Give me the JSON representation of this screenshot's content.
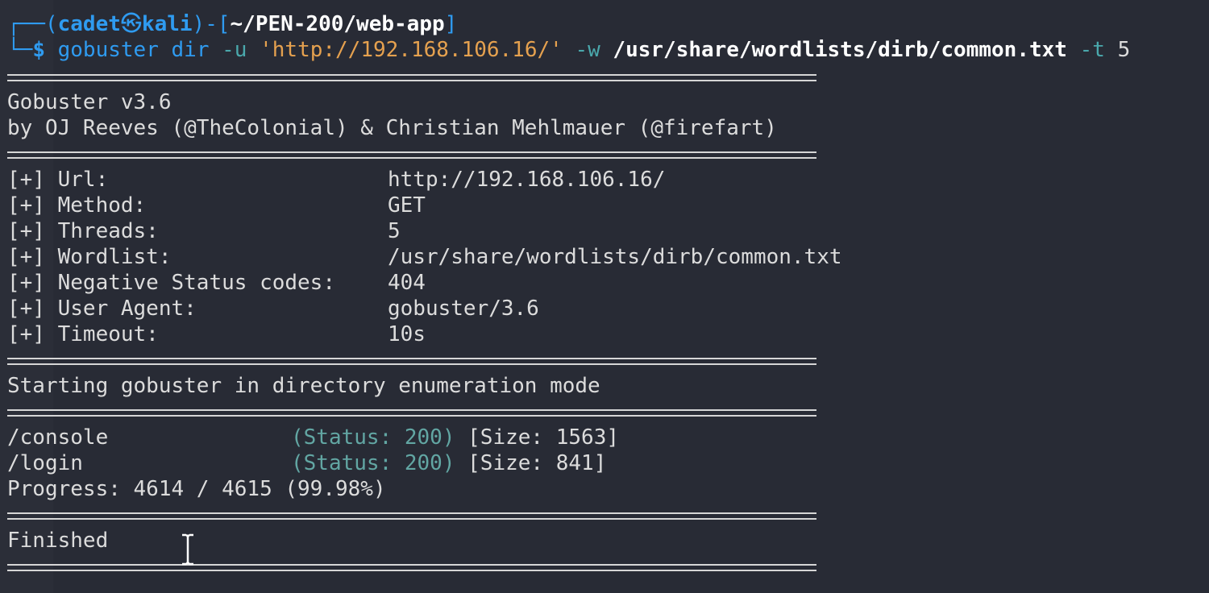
{
  "prompt": {
    "open": "┌──(",
    "user": "cadet",
    "at": "㉿",
    "host": "kali",
    "mid": ")-[",
    "path": "~/PEN-200/web-app",
    "close": "]",
    "second_prefix": "└─",
    "dollar": "$"
  },
  "command": {
    "bin": "gobuster",
    "sub": "dir",
    "flag_u": "-u",
    "url": "'http://192.168.106.16/'",
    "flag_w": "-w",
    "wordlist": "/usr/share/wordlists/dirb/common.txt",
    "flag_t": "-t",
    "threads": "5"
  },
  "banner": {
    "version": "Gobuster v3.6",
    "authors": "by OJ Reeves (@TheColonial) & Christian Mehlmauer (@firefart)"
  },
  "config": [
    {
      "label": "[+] Url:",
      "value": "http://192.168.106.16/"
    },
    {
      "label": "[+] Method:",
      "value": "GET"
    },
    {
      "label": "[+] Threads:",
      "value": "5"
    },
    {
      "label": "[+] Wordlist:",
      "value": "/usr/share/wordlists/dirb/common.txt"
    },
    {
      "label": "[+] Negative Status codes:",
      "value": "404"
    },
    {
      "label": "[+] User Agent:",
      "value": "gobuster/3.6"
    },
    {
      "label": "[+] Timeout:",
      "value": "10s"
    }
  ],
  "start_msg": "Starting gobuster in directory enumeration mode",
  "results": [
    {
      "path": "/console",
      "status": "(Status: 200)",
      "size": "[Size: 1563]"
    },
    {
      "path": "/login",
      "status": "(Status: 200)",
      "size": "[Size: 841]"
    }
  ],
  "progress": "Progress: 4614 / 4615 (99.98%)",
  "finished": "Finished",
  "colors": {
    "background": "#282b35",
    "prompt_blue": "#2f9bf0",
    "string_orange": "#e5a14f",
    "status_teal": "#62a6a3",
    "text": "#dcdcdc"
  }
}
